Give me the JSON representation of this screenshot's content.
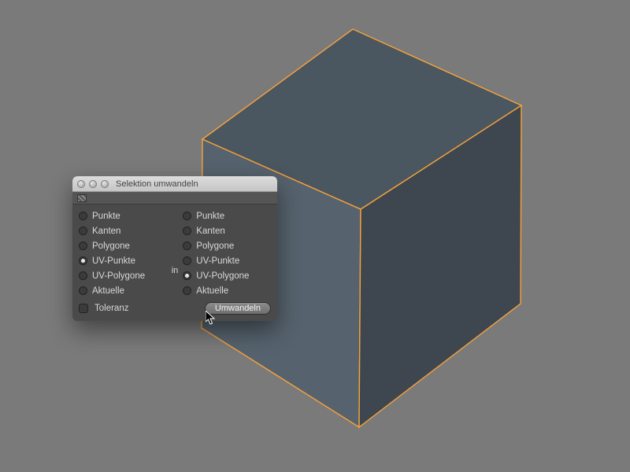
{
  "dialog": {
    "title": "Selektion umwandeln",
    "in_label": "in",
    "left": {
      "items": [
        {
          "label": "Punkte",
          "selected": false
        },
        {
          "label": "Kanten",
          "selected": false
        },
        {
          "label": "Polygone",
          "selected": false
        },
        {
          "label": "UV-Punkte",
          "selected": true
        },
        {
          "label": "UV-Polygone",
          "selected": false
        },
        {
          "label": "Aktuelle",
          "selected": false
        }
      ]
    },
    "right": {
      "items": [
        {
          "label": "Punkte",
          "selected": false
        },
        {
          "label": "Kanten",
          "selected": false
        },
        {
          "label": "Polygone",
          "selected": false
        },
        {
          "label": "UV-Punkte",
          "selected": false
        },
        {
          "label": "UV-Polygone",
          "selected": true
        },
        {
          "label": "Aktuelle",
          "selected": false
        }
      ]
    },
    "tolerance_label": "Toleranz",
    "convert_button": "Umwandeln"
  },
  "cube": {
    "edge_color": "#f8a23a",
    "top_fill": "#4a5660",
    "left_fill": "#56626d",
    "right_fill": "#3e4750"
  }
}
